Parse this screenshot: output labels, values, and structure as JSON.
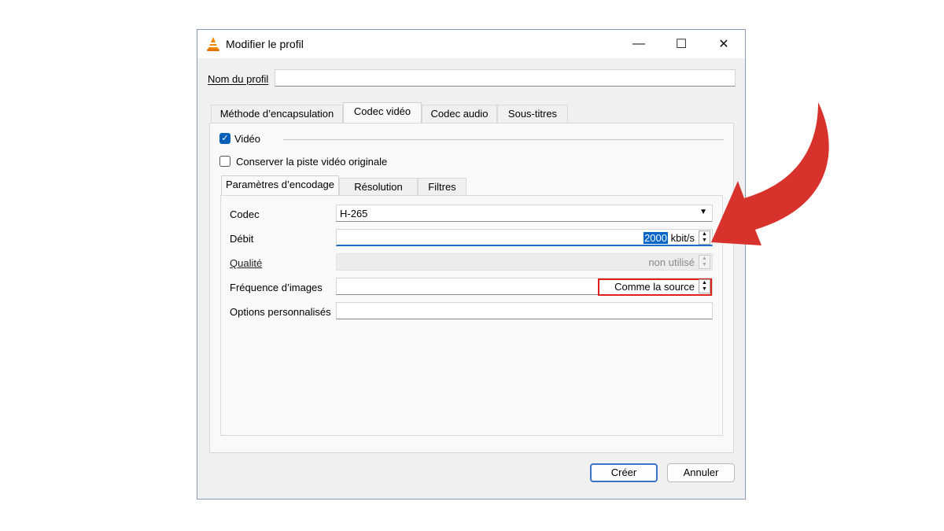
{
  "window": {
    "title": "Modifier le profil",
    "minimize_glyph": "—",
    "maximize_glyph": "☐",
    "close_glyph": "✕"
  },
  "profile": {
    "name_label": "Nom du profil",
    "name_value": ""
  },
  "tabs": [
    {
      "label": "Méthode d’encapsulation",
      "active": false
    },
    {
      "label": "Codec vidéo",
      "active": true
    },
    {
      "label": "Codec audio",
      "active": false
    },
    {
      "label": "Sous-titres",
      "active": false
    }
  ],
  "video": {
    "label": "Vidéo",
    "checked": true,
    "keep_original_label": "Conserver la piste vidéo originale",
    "keep_original_checked": false
  },
  "subtabs": [
    {
      "label": "Paramètres d’encodage",
      "active": true
    },
    {
      "label": "Résolution",
      "active": false
    },
    {
      "label": "Filtres",
      "active": false
    }
  ],
  "form": {
    "codec_label": "Codec",
    "codec_value": "H-265",
    "bitrate_label": "Débit",
    "bitrate_value": "2000",
    "bitrate_unit": "kbit/s",
    "quality_label": "Qualité",
    "quality_value": "non utilisé",
    "framerate_label": "Fréquence d’images",
    "framerate_value": "Comme la source",
    "custom_label": "Options personnalisés",
    "custom_value": ""
  },
  "buttons": {
    "create": "Créer",
    "cancel": "Annuler"
  },
  "colors": {
    "annotation_arrow": "#d7322c",
    "highlight_box": "#e0201c",
    "accent": "#005fb8"
  }
}
